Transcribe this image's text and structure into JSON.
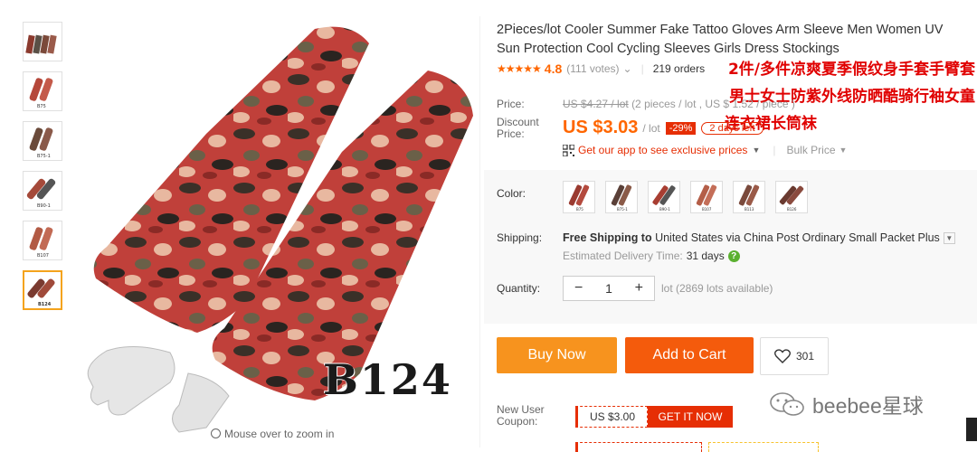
{
  "product": {
    "title": "2Pieces/lot Cooler Summer Fake Tattoo Gloves Arm Sleeve Men Women UV Sun Protection Cool Cycling Sleeves Girls Dress Stockings",
    "image_label": "B124",
    "zoom_hint": "Mouse over to zoom in",
    "thumb_codes": [
      "",
      "B75",
      "B75-1",
      "B90-1",
      "B107",
      "B124"
    ]
  },
  "rating": {
    "stars": "★★★★★",
    "score": "4.8",
    "votes": "(111 votes)",
    "orders": "219 orders"
  },
  "overlay_cn": {
    "line1": "2件/多件凉爽夏季假纹身手套手臂套",
    "line2": "男士女士防紫外线防晒酷骑行袖女童",
    "line3": "连衣裙长筒袜"
  },
  "price": {
    "label": "Price:",
    "old": "US $4.27 / lot",
    "old_note": "(2 pieces / lot , US $ 1.52 / piece )",
    "discount_label_1": "Discount",
    "discount_label_2": "Price:",
    "now": "US $3.03",
    "unit": "/ lot",
    "discount": "-29%",
    "days_left": "2 days left",
    "app_text": "Get our app to see exclusive prices",
    "bulk": "Bulk Price"
  },
  "options": {
    "color_label": "Color:",
    "swatches": [
      "B75",
      "B75-1",
      "B90-1",
      "B107",
      "B113",
      "B126"
    ],
    "shipping_label": "Shipping:",
    "shipping_free": "Free Shipping to",
    "shipping_rest": " United States via China Post Ordinary Small Packet Plus",
    "delivery_label": "Estimated Delivery Time:",
    "delivery_days": "31 days",
    "quantity_label": "Quantity:",
    "quantity": "1",
    "lots_available": "lot (2869 lots available)"
  },
  "actions": {
    "buy_now": "Buy Now",
    "add_to_cart": "Add to Cart",
    "wishlist_count": "301"
  },
  "coupon": {
    "label_1": "New User",
    "label_2": "Coupon:",
    "value": "US $3.00",
    "get": "GET IT NOW"
  },
  "watermark": "beebee星球",
  "colors": {
    "accent_orange": "#f60",
    "buy_now": "#f7931e",
    "add_to_cart": "#f45b0c",
    "discount_red": "#e62e04",
    "cn_red": "#e00000"
  }
}
